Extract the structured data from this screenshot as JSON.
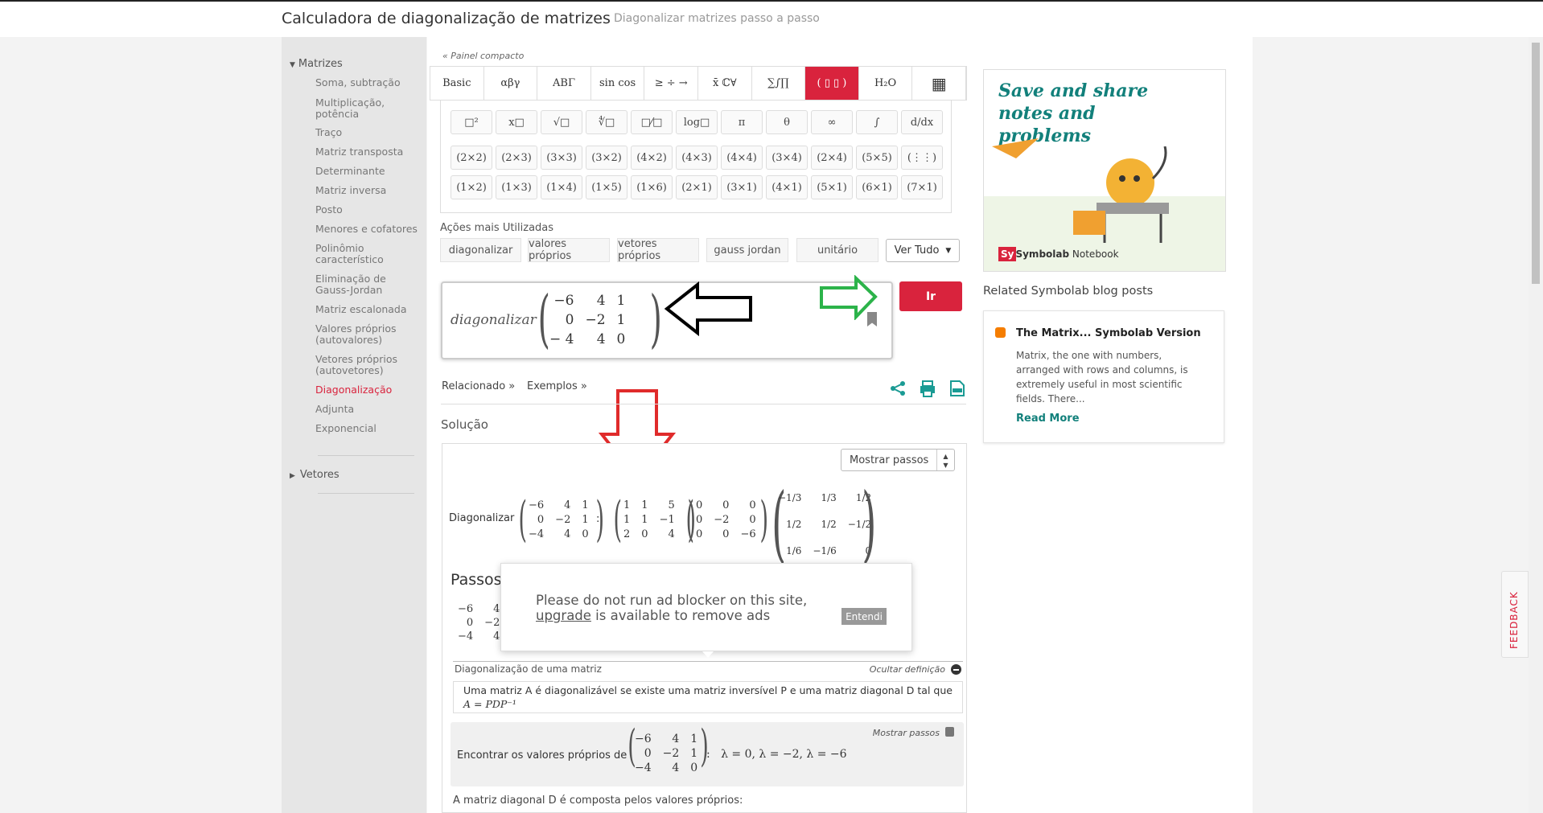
{
  "header": {
    "title": "Calculadora de diagonalização de matrizes",
    "subtitle": "Diagonalizar matrizes passo a passo"
  },
  "sidebar": {
    "section_matrizes": "Matrizes",
    "items": [
      "Soma, subtração",
      "Multiplicação, potência",
      "Traço",
      "Matriz transposta",
      "Determinante",
      "Matriz inversa",
      "Posto",
      "Menores e cofatores",
      "Polinômio característico",
      "Eliminação de Gauss-Jordan",
      "Matriz escalonada",
      "Valores próprios (autovalores)",
      "Vetores próprios (autovetores)",
      "Diagonalização",
      "Adjunta",
      "Exponencial"
    ],
    "section_vetores": "Vetores"
  },
  "keyboard": {
    "panel_link": "« Painel compacto",
    "tabs": [
      "Basic",
      "αβγ",
      "ABΓ",
      "sin cos",
      "≥ ÷ →",
      "x̄ ℂ∀",
      "∑∫∏",
      "( ▯ ▯ )",
      "H₂O",
      "▦"
    ],
    "row1": [
      "□²",
      "x□",
      "√□",
      "∜□",
      "□⁄□",
      "log□",
      "π",
      "θ",
      "∞",
      "∫",
      "d/dx"
    ],
    "row2": [
      "(2×2)",
      "(2×3)",
      "(3×3)",
      "(3×2)",
      "(4×2)",
      "(4×3)",
      "(4×4)",
      "(3×4)",
      "(2×4)",
      "(5×5)",
      "(⋮⋮)"
    ],
    "row3": [
      "(1×2)",
      "(1×3)",
      "(1×4)",
      "(1×5)",
      "(1×6)",
      "(2×1)",
      "(3×1)",
      "(4×1)",
      "(5×1)",
      "(6×1)",
      "(7×1)"
    ]
  },
  "actions": {
    "label": "Ações mais Utilizadas",
    "pills": [
      "diagonalizar",
      "valores próprios",
      "vetores próprios",
      "gauss jordan",
      "unitário"
    ],
    "ver_tudo": "Ver Tudo"
  },
  "input": {
    "keyword": "diagonalizar",
    "matrix": [
      [
        "−6",
        "4",
        "1"
      ],
      [
        "0",
        "−2",
        "1"
      ],
      [
        "− 4",
        "4",
        "0"
      ]
    ],
    "go": "Ir"
  },
  "links": {
    "relacionado": "Relacionado »",
    "exemplos": "Exemplos »"
  },
  "solution": {
    "heading": "Solução",
    "mostrar_passos": "Mostrar passos",
    "diag_label": "Diagonalizar",
    "A": [
      [
        "−6",
        "4",
        "1"
      ],
      [
        "0",
        "−2",
        "1"
      ],
      [
        "−4",
        "4",
        "0"
      ]
    ],
    "P": [
      [
        "1",
        "1",
        "5"
      ],
      [
        "1",
        "1",
        "−1"
      ],
      [
        "2",
        "0",
        "4"
      ]
    ],
    "D": [
      [
        "0",
        "0",
        "0"
      ],
      [
        "0",
        "−2",
        "0"
      ],
      [
        "0",
        "0",
        "−6"
      ]
    ],
    "Pinv": [
      [
        "−1/3",
        "1/3",
        "1/2"
      ],
      [
        "1/2",
        "1/2",
        "−1/2"
      ],
      [
        "1/6",
        "−1/6",
        "0"
      ]
    ],
    "passos": "Passos",
    "def_title": "Diagonalização de uma matriz",
    "def_hide": "Ocultar definição",
    "def_text": "Uma matriz A é diagonalizável se existe uma matriz inversível P e uma matriz diagonal D tal que",
    "def_formula": "A = PDP⁻¹",
    "step_mostrar": "Mostrar passos",
    "step_label": "Encontrar os valores próprios de",
    "step_result": "λ = 0, λ = −2, λ = −6",
    "bottom_text": "A matriz diagonal D é composta pelos valores próprios:"
  },
  "ad": {
    "line1": "Please do not run ad blocker on this site,",
    "upgrade": "upgrade",
    "line2": " is available to remove ads",
    "button": "Entendi"
  },
  "notebook": {
    "title": "Save and share notes and problems",
    "brand": "Symbolab",
    "product": "Notebook"
  },
  "blog": {
    "heading": "Related Symbolab blog posts",
    "post_title": "The Matrix... Symbolab Version",
    "post_text": "Matrix, the one with numbers, arranged with rows and columns, is extremely useful in most scientific fields. There...",
    "read_more": "Read More"
  },
  "feedback": "FEEDBACK",
  "colors": {
    "accent": "#d9233d",
    "teal": "#12807b"
  }
}
